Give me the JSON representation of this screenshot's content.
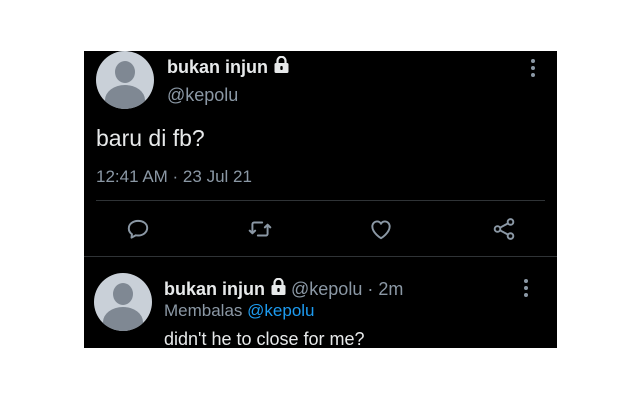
{
  "tweet": {
    "display_name": "bukan injun",
    "handle": "@kepolu",
    "text": "baru di fb?",
    "time": "12:41 AM · 23 Jul 21",
    "protected_icon": "lock-icon",
    "more_icon": "more-vertical-icon",
    "actions": [
      {
        "name": "reply",
        "icon": "reply-icon"
      },
      {
        "name": "retweet",
        "icon": "retweet-icon"
      },
      {
        "name": "like",
        "icon": "heart-icon"
      },
      {
        "name": "share",
        "icon": "share-icon"
      }
    ]
  },
  "reply": {
    "display_name": "bukan injun",
    "handle_time": "@kepolu · 2m",
    "replying_label": "Membalas",
    "replying_to": "@kepolu",
    "text": "didn't he to close for me?"
  },
  "colors": {
    "background": "#000000",
    "text": "#e7e9ea",
    "secondary": "#8b98a5",
    "link": "#1d9bf0",
    "divider": "#2f3336"
  }
}
